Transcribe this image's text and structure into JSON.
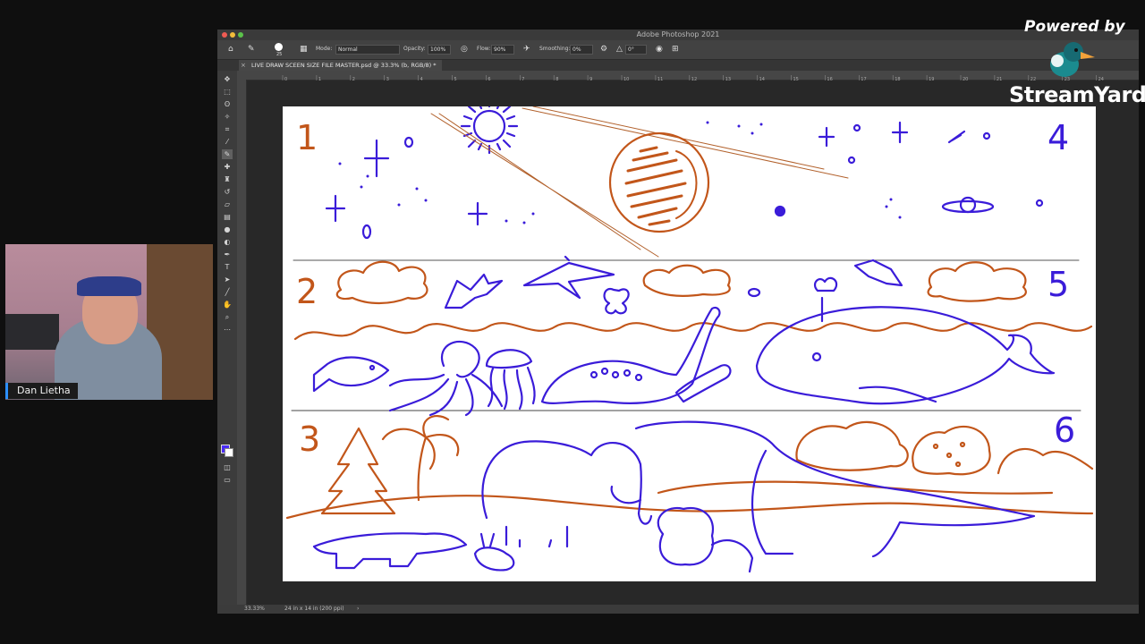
{
  "app": {
    "window_title": "Adobe Photoshop 2021"
  },
  "options_bar": {
    "brush_size": "25",
    "mode_label": "Mode:",
    "mode_value": "Normal",
    "opacity_label": "Opacity:",
    "opacity_value": "100%",
    "flow_label": "Flow:",
    "flow_value": "90%",
    "smoothing_label": "Smoothing:",
    "smoothing_value": "0%",
    "angle_value": "0°"
  },
  "document": {
    "tab_label": "LIVE DRAW SCEEN SIZE FILE MASTER.psd @ 33.3% (b, RGB/8) *",
    "zoom": "33.33%",
    "doc_size": "24 in x 14 in (200 ppi)"
  },
  "ruler": {
    "marks": [
      "0",
      "1",
      "2",
      "3",
      "4",
      "5",
      "6",
      "7",
      "8",
      "9",
      "10",
      "11",
      "12",
      "13",
      "14",
      "15",
      "16",
      "17",
      "18",
      "19",
      "20",
      "21",
      "22",
      "23",
      "24"
    ]
  },
  "canvas": {
    "numbers": [
      "1",
      "2",
      "3",
      "4",
      "5",
      "6"
    ],
    "colors": {
      "blue": "#3a1cd9",
      "orange": "#c2561a",
      "black": "#333333"
    }
  },
  "presenter": {
    "name": "Dan Lietha"
  },
  "branding": {
    "powered_by": "Powered by",
    "logo_text": "StreamYard"
  },
  "colors": {
    "foreground": "#4a2cf5",
    "background": "#ffffff"
  }
}
